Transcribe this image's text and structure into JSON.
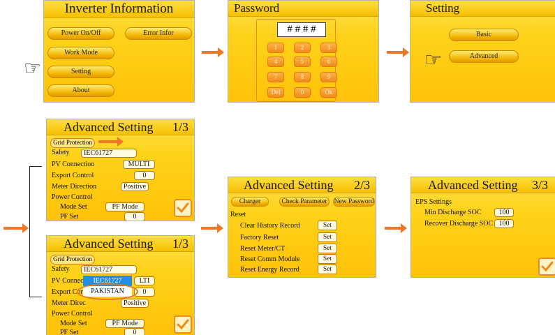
{
  "panel1": {
    "title": "Inverter Information",
    "buttons": [
      "Power On/Off",
      "Error Infor",
      "Work Mode",
      "Setting",
      "About"
    ]
  },
  "panel2": {
    "title": "Password",
    "display": "# # # #",
    "keys": [
      "1",
      "2",
      "3",
      "4",
      "5",
      "6",
      "7",
      "8",
      "9",
      "Del",
      "0",
      "Ok"
    ]
  },
  "panel3": {
    "title": "Setting",
    "buttons": [
      "Basic",
      "Advanced"
    ]
  },
  "adv1": {
    "title": "Advanced Setting",
    "page": "1/3",
    "grid_protection": "Grid Protection",
    "safety_label": "Safety",
    "safety_value": "IEC61727",
    "pv_label": "PV Connection",
    "pv_value": "MULTI",
    "export_label": "Export Control",
    "export_value": "0",
    "meter_label": "Meter Direction",
    "meter_value": "Positive",
    "power_label": "Power Control",
    "mode_label": "Mode Set",
    "mode_value": "PF Mode",
    "pf_label": "PF Set",
    "pf_value": "0"
  },
  "adv1b": {
    "title": "Advanced Setting",
    "page": "1/3",
    "grid_protection": "Grid Protection",
    "safety_label": "Safety",
    "safety_value": "IEC61727",
    "pv_label": "PV Connec",
    "pv_value": "LTI",
    "export_label": "Export Cor",
    "export_value": "0",
    "meter_label": "Meter Direc",
    "meter_value": "Positive",
    "power_label": "Power Control",
    "mode_label": "Mode Set",
    "mode_value": "PF Mode",
    "pf_label": "PF Set",
    "pf_value": "0",
    "dropdown": [
      "IEC61727",
      "PAKISTAN"
    ]
  },
  "adv2": {
    "title": "Advanced Setting",
    "page": "2/3",
    "tabs": [
      "Charger",
      "Check Parameter",
      "New Password"
    ],
    "reset": "Reset",
    "rows": [
      "Clear History Record",
      "Factory Reset",
      "Reset Meter/CT",
      "Reset Comm Module",
      "Reset Energy Record"
    ],
    "set_label": "Set"
  },
  "adv3": {
    "title": "Advanced Setting",
    "page": "3/3",
    "eps": "EPS Settings",
    "min_label": "Min Discharge SOC",
    "min_value": "100",
    "rec_label": "Recover Discharge SOC",
    "rec_value": "100"
  },
  "colors": {
    "accent": "#ee7826",
    "panel": "#ffd21a"
  },
  "icons": {
    "pointer": "pointing-hand-icon",
    "confirm": "checkmark-icon",
    "flow": "arrow-right-icon"
  }
}
